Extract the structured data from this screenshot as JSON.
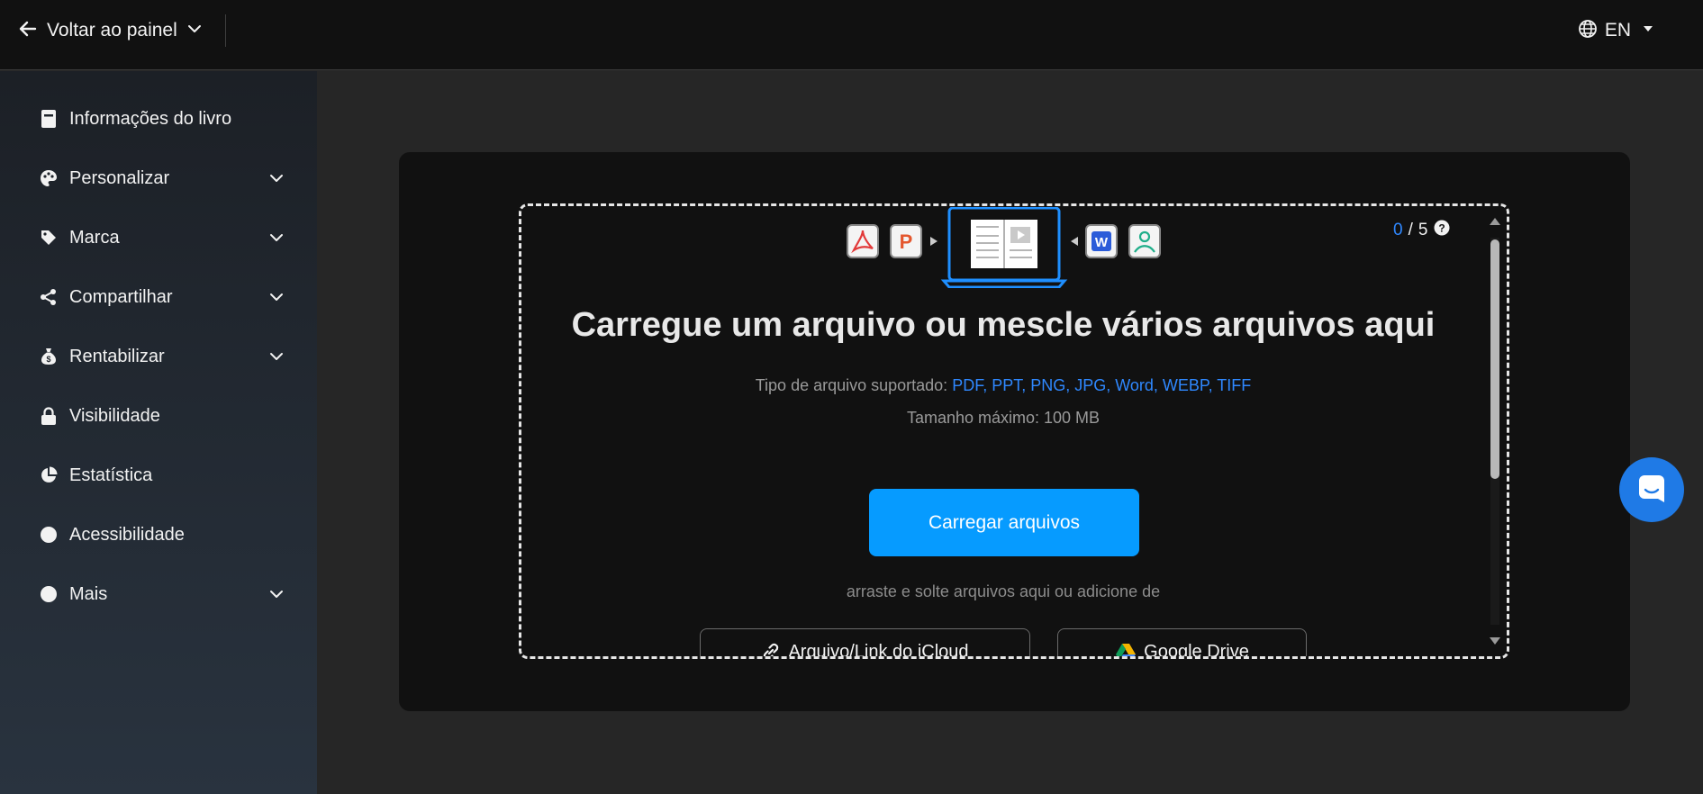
{
  "topbar": {
    "back_label": "Voltar ao painel",
    "back_icon": "arrow-left-icon",
    "back_dropdown_icon": "chevron-down-icon",
    "language": "EN",
    "language_icon": "globe-icon"
  },
  "sidebar": {
    "items": [
      {
        "label": "Informações do livro",
        "icon": "book-icon",
        "expandable": false
      },
      {
        "label": "Personalizar",
        "icon": "palette-icon",
        "expandable": true
      },
      {
        "label": "Marca",
        "icon": "tag-icon",
        "expandable": true
      },
      {
        "label": "Compartilhar",
        "icon": "share-icon",
        "expandable": true
      },
      {
        "label": "Rentabilizar",
        "icon": "money-bag-icon",
        "expandable": true
      },
      {
        "label": "Visibilidade",
        "icon": "lock-icon",
        "expandable": false
      },
      {
        "label": "Estatística",
        "icon": "pie-chart-icon",
        "expandable": false
      },
      {
        "label": "Acessibilidade",
        "icon": "accessibility-icon",
        "expandable": false
      },
      {
        "label": "Mais",
        "icon": "more-icon",
        "expandable": true
      }
    ]
  },
  "upload": {
    "counter_current": "0",
    "counter_separator": "/",
    "counter_max": "5",
    "headline": "Carregue um arquivo ou mescle vários arquivos aqui",
    "types_label": "Tipo de arquivo suportado:",
    "types_list": "PDF, PPT, PNG, JPG, Word, WEBP, TIFF",
    "max_size": "Tamanho máximo: 100 MB",
    "upload_button": "Carregar arquivos",
    "drag_hint": "arraste e solte arquivos aqui ou adicione de",
    "icloud_label": "Arquivo/Link do iCloud",
    "gdrive_label": "Google Drive"
  },
  "colors": {
    "accent": "#069bff",
    "link_blue": "#2f88ff",
    "chat_bubble": "#1f7ae6"
  }
}
